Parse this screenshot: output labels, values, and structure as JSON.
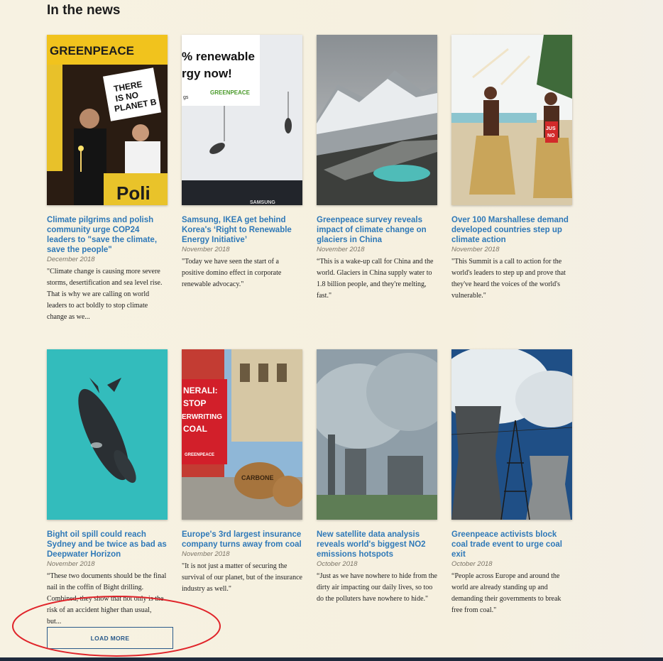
{
  "section": {
    "title": "In the news"
  },
  "articles": [
    {
      "title": "Climate pilgrims and polish community urge COP24 leaders to \"save the climate, save the people\"",
      "date": "December 2018",
      "excerpt": "\"Climate change is causing more severe storms, desertification and sea level rise. That is why we are calling on world leaders to act boldly to stop climate change as we...",
      "image_text": [
        "GREENPEACE",
        "THERE",
        "IS NO",
        "PLANET B",
        "Poli"
      ]
    },
    {
      "title": "Samsung, IKEA get behind Korea's ‘Right to Renewable Energy Initiative’",
      "date": "November 2018",
      "excerpt": "\"Today we have seen the start of a positive domino effect in corporate renewable advocacy.\"",
      "image_text": [
        "% renewable",
        "rgy now!",
        "GREENPEACE",
        "gs",
        "SAMSUNG"
      ]
    },
    {
      "title": "Greenpeace survey reveals impact of climate change on glaciers in China",
      "date": "November 2018",
      "excerpt": "“This is a wake-up call for China and the world. Glaciers in China supply water to 1.8 billion people, and they're melting, fast.\"",
      "image_text": []
    },
    {
      "title": "Over 100 Marshallese demand developed countries step up climate action",
      "date": "November 2018",
      "excerpt": "\"This Summit is a call to action for the world's leaders to step up and prove that they've heard the voices of the world's vulnerable.\"",
      "image_text": [
        "JUS",
        "NO"
      ]
    },
    {
      "title": "Bight oil spill could reach Sydney and be twice as bad as Deepwater Horizon",
      "date": "November 2018",
      "excerpt": "“These two documents should be the final nail in the coffin of Bight drilling. Combined, they show that not only is the risk of an accident higher than usual, but...",
      "image_text": []
    },
    {
      "title": "Europe's 3rd largest insurance company turns away from coal",
      "date": "November 2018",
      "excerpt": "\"It is not just a matter of securing the survival of our planet, but of the insurance industry as well.\"",
      "image_text": [
        "NERALI:",
        "STOP",
        "ERWRITING",
        "COAL",
        "GREENPEACE",
        "CARBONE"
      ]
    },
    {
      "title": "New satellite data analysis reveals world's biggest NO2 emissions hotspots",
      "date": "October 2018",
      "excerpt": "“Just as we have nowhere to hide from the dirty air impacting our daily lives, so too do the polluters have nowhere to hide.\"",
      "image_text": []
    },
    {
      "title": "Greenpeace activists block coal trade event to urge coal exit",
      "date": "October 2018",
      "excerpt": "“People across Europe and around the world are already standing up and demanding their governments to break free from coal.\"",
      "image_text": []
    }
  ],
  "load_more": {
    "label": "LOAD MORE"
  },
  "colors": {
    "background": "#f6f0df",
    "link": "#2f79b8",
    "annotation": "#e0242a",
    "button_border": "#2a5a8a"
  },
  "icons": {
    "load_more_highlight": "red-ellipse-annotation"
  }
}
